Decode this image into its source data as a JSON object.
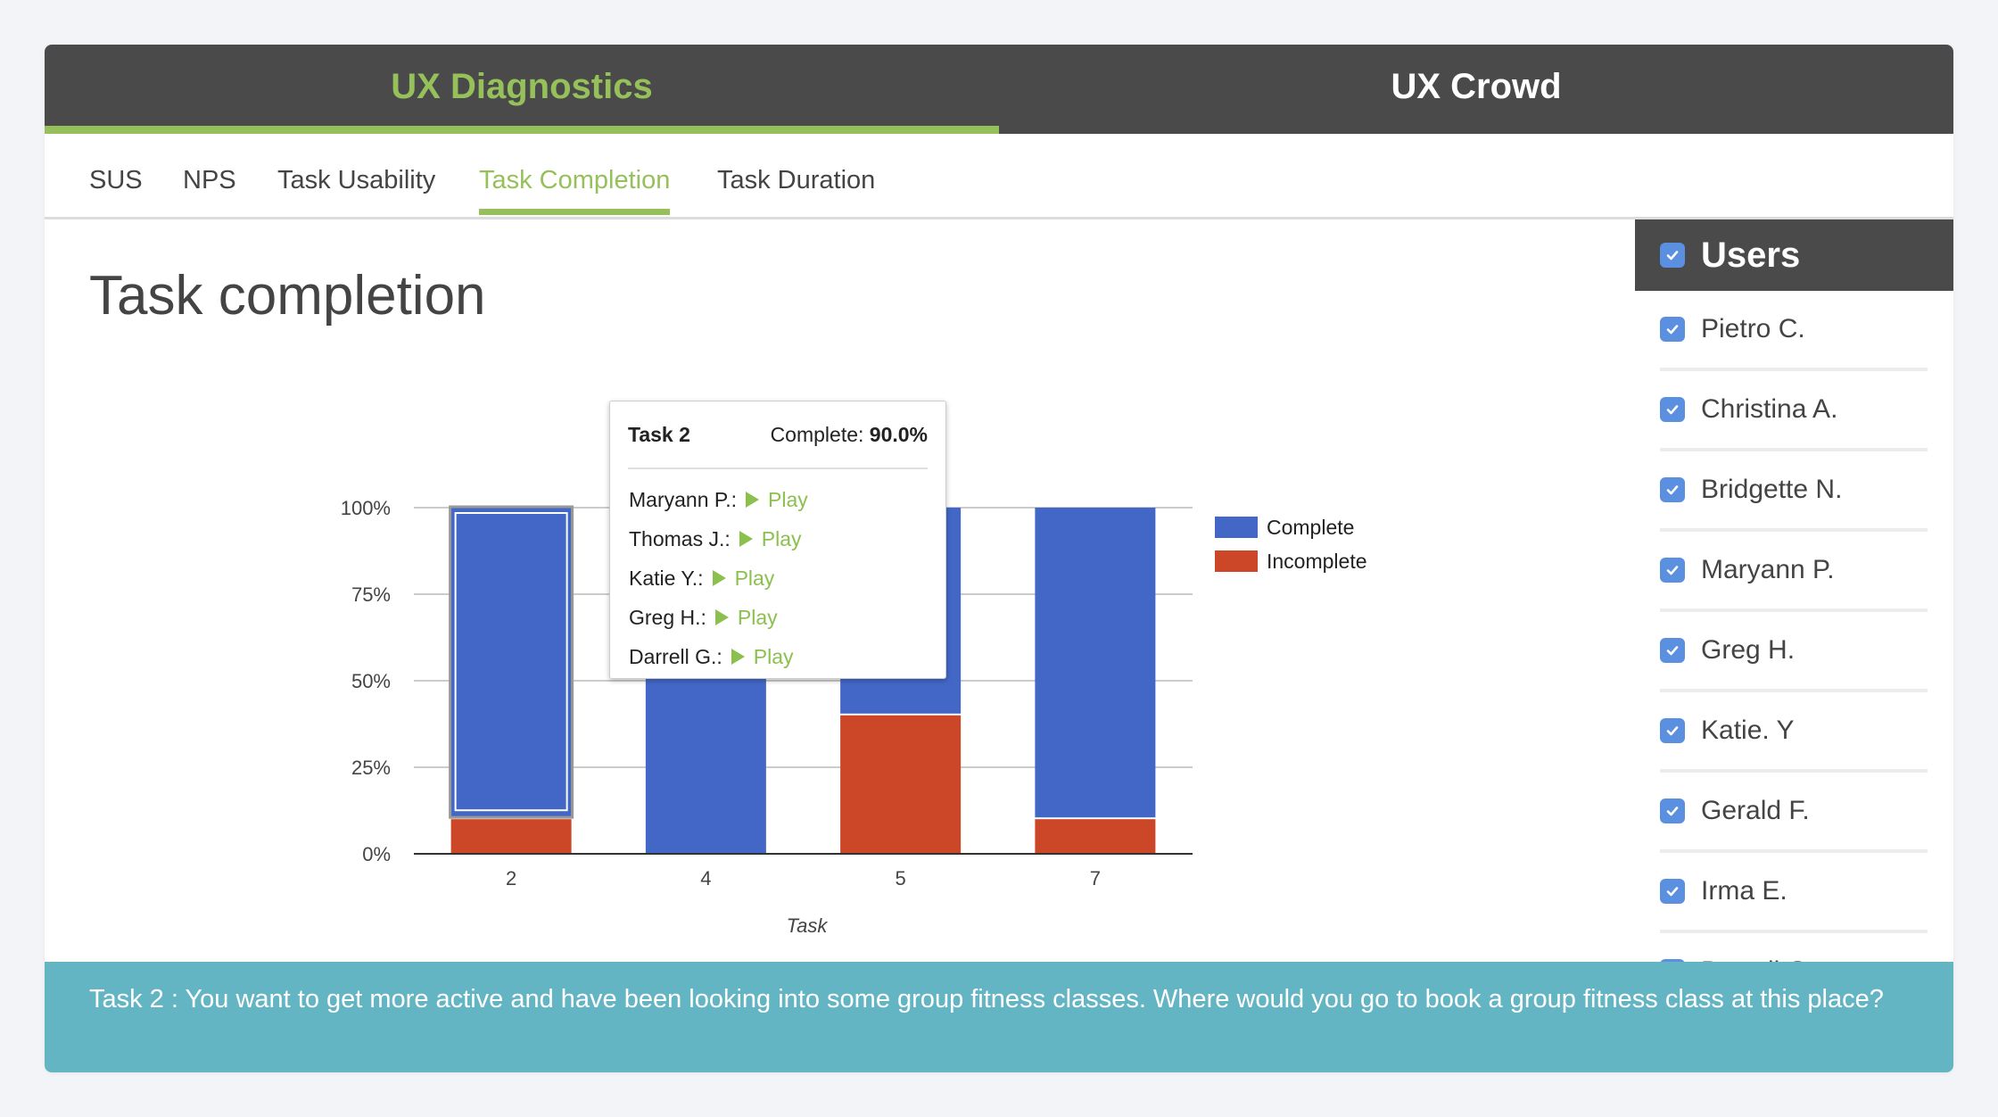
{
  "header": {
    "tabs": [
      {
        "label": "UX Diagnostics",
        "active": true
      },
      {
        "label": "UX Crowd",
        "active": false
      }
    ]
  },
  "subnav": {
    "tabs": [
      {
        "label": "SUS",
        "active": false
      },
      {
        "label": "NPS",
        "active": false
      },
      {
        "label": "Task Usability",
        "active": false
      },
      {
        "label": "Task Completion",
        "active": true
      },
      {
        "label": "Task Duration",
        "active": false
      }
    ]
  },
  "page_title": "Task completion",
  "chart_data": {
    "type": "bar",
    "stacked": true,
    "normalized": true,
    "categories": [
      "2",
      "4",
      "5",
      "7"
    ],
    "series": [
      {
        "name": "Incomplete",
        "color": "#cc4628",
        "values": [
          10,
          0,
          40,
          10
        ]
      },
      {
        "name": "Complete",
        "color": "#4267c6",
        "values": [
          90,
          100,
          60,
          90
        ]
      }
    ],
    "xlabel": "Task",
    "ylabel": "",
    "ylim": [
      0,
      100
    ],
    "yticks": [
      "0%",
      "25%",
      "50%",
      "75%",
      "100%"
    ],
    "grid": true,
    "legend": {
      "position": "right",
      "entries": [
        "Complete",
        "Incomplete"
      ]
    },
    "highlighted_category": "2"
  },
  "tooltip": {
    "title": "Task 2",
    "complete_label": "Complete:",
    "complete_value": "90.0%",
    "rows": [
      {
        "name": "Maryann P.:",
        "action": "Play"
      },
      {
        "name": "Thomas J.:",
        "action": "Play"
      },
      {
        "name": "Katie Y.:",
        "action": "Play"
      },
      {
        "name": "Greg H.:",
        "action": "Play"
      },
      {
        "name": "Darrell G.:",
        "action": "Play"
      }
    ]
  },
  "sidebar": {
    "title": "Users",
    "users": [
      {
        "name": "Pietro C.",
        "checked": true
      },
      {
        "name": "Christina A.",
        "checked": true
      },
      {
        "name": "Bridgette N.",
        "checked": true
      },
      {
        "name": "Maryann P.",
        "checked": true
      },
      {
        "name": "Greg H.",
        "checked": true
      },
      {
        "name": "Katie. Y",
        "checked": true
      },
      {
        "name": "Gerald F.",
        "checked": true
      },
      {
        "name": "Irma E.",
        "checked": true
      },
      {
        "name": "Darrell G.",
        "checked": true
      }
    ]
  },
  "banner": {
    "text": "Task 2 : You want to get more active and have been looking into some group fitness classes. Where would you go to book a group fitness class at this place?"
  },
  "colors": {
    "accent_green": "#96c05a",
    "header_dark": "#4a4a4a",
    "checkbox_blue": "#5b8fe0",
    "banner_teal": "#64b5c4"
  }
}
